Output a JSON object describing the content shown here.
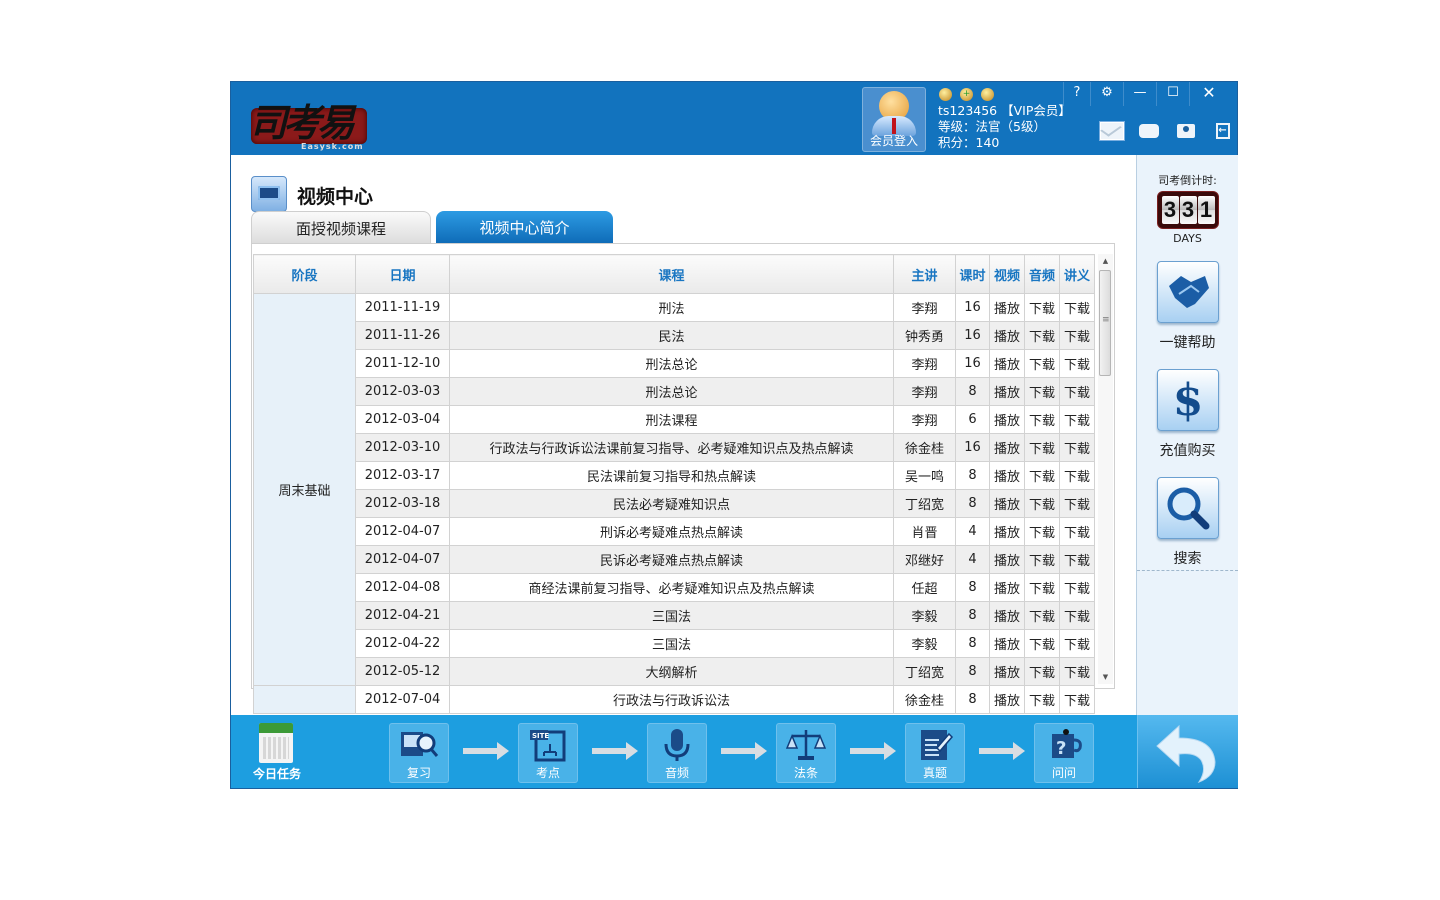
{
  "header": {
    "logo_text": "司考易",
    "logo_url_text": "Easysk.com",
    "member_button_label": "会员登入",
    "username": "ts123456 【VIP会员】",
    "level": "等级：法官（5级）",
    "points": "积分：140",
    "window_controls": {
      "help": "?",
      "settings": "⚙",
      "minimize": "—",
      "maximize": "☐",
      "close": "✕"
    }
  },
  "main": {
    "page_title": "视频中心",
    "tabs": [
      {
        "label": "面授视频课程",
        "active": true
      },
      {
        "label": "视频中心简介",
        "active": false
      }
    ],
    "table": {
      "columns": [
        "阶段",
        "日期",
        "课程",
        "主讲",
        "课时",
        "视频",
        "音频",
        "讲义"
      ],
      "stage_groups": [
        {
          "stage": "周末基础",
          "rows": 14
        },
        {
          "stage": "",
          "rows": 1
        }
      ],
      "rows": [
        {
          "date": "2011-11-19",
          "course": "刑法",
          "lecturer": "李翔",
          "hours": "16",
          "video": "播放",
          "audio": "下载",
          "notes": "下载"
        },
        {
          "date": "2011-11-26",
          "course": "民法",
          "lecturer": "钟秀勇",
          "hours": "16",
          "video": "播放",
          "audio": "下载",
          "notes": "下载"
        },
        {
          "date": "2011-12-10",
          "course": "刑法总论",
          "lecturer": "李翔",
          "hours": "16",
          "video": "播放",
          "audio": "下载",
          "notes": "下载"
        },
        {
          "date": "2012-03-03",
          "course": "刑法总论",
          "lecturer": "李翔",
          "hours": "8",
          "video": "播放",
          "audio": "下载",
          "notes": "下载"
        },
        {
          "date": "2012-03-04",
          "course": "刑法课程",
          "lecturer": "李翔",
          "hours": "6",
          "video": "播放",
          "audio": "下载",
          "notes": "下载"
        },
        {
          "date": "2012-03-10",
          "course": "行政法与行政诉讼法课前复习指导、必考疑难知识点及热点解读",
          "lecturer": "徐金桂",
          "hours": "16",
          "video": "播放",
          "audio": "下载",
          "notes": "下载"
        },
        {
          "date": "2012-03-17",
          "course": "民法课前复习指导和热点解读",
          "lecturer": "吴一鸣",
          "hours": "8",
          "video": "播放",
          "audio": "下载",
          "notes": "下载"
        },
        {
          "date": "2012-03-18",
          "course": "民法必考疑难知识点",
          "lecturer": "丁绍宽",
          "hours": "8",
          "video": "播放",
          "audio": "下载",
          "notes": "下载"
        },
        {
          "date": "2012-04-07",
          "course": "刑诉必考疑难点热点解读",
          "lecturer": "肖晋",
          "hours": "4",
          "video": "播放",
          "audio": "下载",
          "notes": "下载"
        },
        {
          "date": "2012-04-07",
          "course": "民诉必考疑难点热点解读",
          "lecturer": "邓继好",
          "hours": "4",
          "video": "播放",
          "audio": "下载",
          "notes": "下载"
        },
        {
          "date": "2012-04-08",
          "course": "商经法课前复习指导、必考疑难知识点及热点解读",
          "lecturer": "任超",
          "hours": "8",
          "video": "播放",
          "audio": "下载",
          "notes": "下载"
        },
        {
          "date": "2012-04-21",
          "course": "三国法",
          "lecturer": "李毅",
          "hours": "8",
          "video": "播放",
          "audio": "下载",
          "notes": "下载"
        },
        {
          "date": "2012-04-22",
          "course": "三国法",
          "lecturer": "李毅",
          "hours": "8",
          "video": "播放",
          "audio": "下载",
          "notes": "下载"
        },
        {
          "date": "2012-05-12",
          "course": "大纲解析",
          "lecturer": "丁绍宽",
          "hours": "8",
          "video": "播放",
          "audio": "下载",
          "notes": "下载"
        },
        {
          "date": "2012-07-04",
          "course": "行政法与行政诉讼法",
          "lecturer": "徐金桂",
          "hours": "8",
          "video": "播放",
          "audio": "下载",
          "notes": "下载"
        }
      ]
    }
  },
  "sidebar": {
    "countdown_label": "司考倒计时:",
    "countdown_digits": [
      "3",
      "3",
      "1"
    ],
    "countdown_unit": "DAYS",
    "buttons": [
      {
        "label": "一键帮助",
        "icon": "handshake-icon"
      },
      {
        "label": "充值购买",
        "icon": "dollar-icon"
      },
      {
        "label": "搜索",
        "icon": "magnifier-icon"
      }
    ]
  },
  "footer": {
    "today_label": "今日任务",
    "steps": [
      {
        "label": "复习",
        "icon": "review-icon"
      },
      {
        "label": "考点",
        "icon": "site-map-icon"
      },
      {
        "label": "音频",
        "icon": "microphone-icon"
      },
      {
        "label": "法条",
        "icon": "scales-icon"
      },
      {
        "label": "真题",
        "icon": "exam-paper-icon"
      },
      {
        "label": "问问",
        "icon": "question-icon"
      }
    ],
    "back_label": "返回"
  },
  "colors": {
    "header_blue": "#1273be",
    "footer_blue": "#1d9ee0",
    "column_header_text": "#1976c2",
    "sidebar_bg": "#eaf3fb"
  }
}
